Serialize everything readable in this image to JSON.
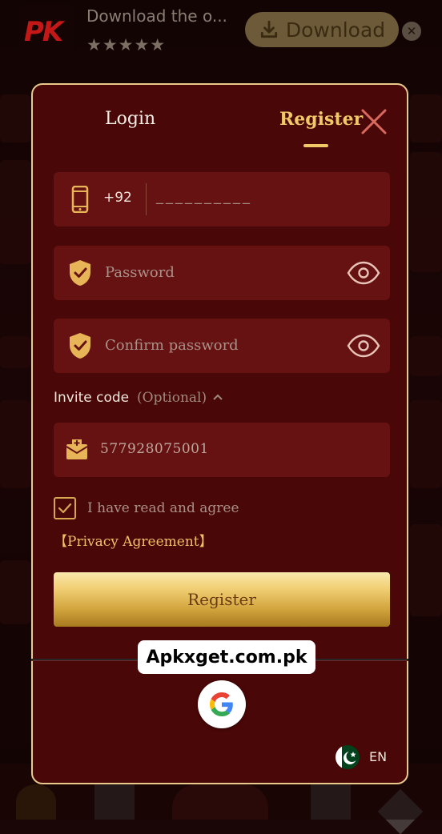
{
  "banner": {
    "app_logo_text": "PK",
    "title": "Download the o...",
    "stars": "★★★★★",
    "download_label": "Download",
    "close_label": "✕"
  },
  "modal": {
    "tabs": [
      {
        "label": "Login",
        "active": false
      },
      {
        "label": "Register",
        "active": true
      }
    ],
    "phone": {
      "country_code": "+92",
      "placeholder": "__________"
    },
    "password": {
      "placeholder": "Password"
    },
    "confirm_password": {
      "placeholder": "Confirm password"
    },
    "invite": {
      "label": "Invite code",
      "optional": "(Optional)",
      "value": "577928075001"
    },
    "agreement": {
      "text": "I have read and agree",
      "link": "【Privacy Agreement】",
      "checked": true
    },
    "register_button": "Register",
    "language": "EN"
  },
  "watermark": "Apkxget.com.pk",
  "colors": {
    "modal_bg": "#4a0707",
    "field_bg": "#671212",
    "gold": "#f0c867",
    "border": "#e9c98c"
  },
  "icons": [
    "phone-icon",
    "shield-check-icon",
    "eye-icon",
    "envelope-icon",
    "checkmark-icon",
    "google-icon",
    "pakistan-flag-icon",
    "close-icon",
    "download-icon",
    "chevron-up-icon"
  ]
}
